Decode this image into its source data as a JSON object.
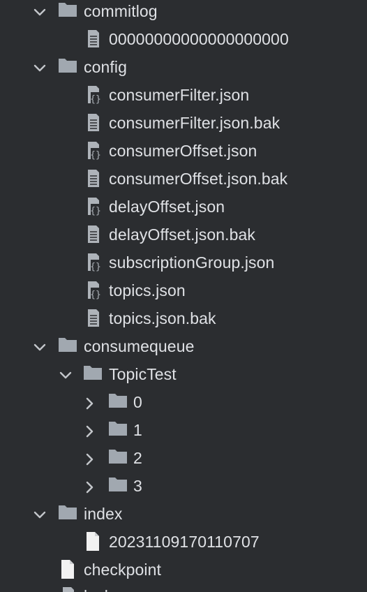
{
  "project_tree": {
    "nodes": [
      {
        "label": "commitlog",
        "type": "folder",
        "expanded": true,
        "depth": 1
      },
      {
        "label": "00000000000000000000",
        "type": "file-text",
        "depth": 2
      },
      {
        "label": "config",
        "type": "folder",
        "expanded": true,
        "depth": 1
      },
      {
        "label": "consumerFilter.json",
        "type": "file-json",
        "depth": 2
      },
      {
        "label": "consumerFilter.json.bak",
        "type": "file-text",
        "depth": 2
      },
      {
        "label": "consumerOffset.json",
        "type": "file-json",
        "depth": 2
      },
      {
        "label": "consumerOffset.json.bak",
        "type": "file-text",
        "depth": 2
      },
      {
        "label": "delayOffset.json",
        "type": "file-json",
        "depth": 2
      },
      {
        "label": "delayOffset.json.bak",
        "type": "file-text",
        "depth": 2
      },
      {
        "label": "subscriptionGroup.json",
        "type": "file-json",
        "depth": 2
      },
      {
        "label": "topics.json",
        "type": "file-json",
        "depth": 2
      },
      {
        "label": "topics.json.bak",
        "type": "file-text",
        "depth": 2
      },
      {
        "label": "consumequeue",
        "type": "folder",
        "expanded": true,
        "depth": 1
      },
      {
        "label": "TopicTest",
        "type": "folder",
        "expanded": true,
        "depth": 2
      },
      {
        "label": "0",
        "type": "folder",
        "expanded": false,
        "depth": 3
      },
      {
        "label": "1",
        "type": "folder",
        "expanded": false,
        "depth": 3
      },
      {
        "label": "2",
        "type": "folder",
        "expanded": false,
        "depth": 3
      },
      {
        "label": "3",
        "type": "folder",
        "expanded": false,
        "depth": 3
      },
      {
        "label": "index",
        "type": "folder",
        "expanded": true,
        "depth": 1
      },
      {
        "label": "20231109170110707",
        "type": "file-blank",
        "depth": 2
      },
      {
        "label": "checkpoint",
        "type": "file-blank",
        "depth": 1
      },
      {
        "label": "lock",
        "type": "file-text",
        "depth": 1
      }
    ]
  },
  "colors": {
    "background": "#2b2d30",
    "text": "#dfe1e5",
    "folder_icon": "#a1a8b0",
    "file_icon": "#aeb3b9",
    "blank_file_icon": "#f2f2f2",
    "chevron": "#c3c6ca"
  }
}
